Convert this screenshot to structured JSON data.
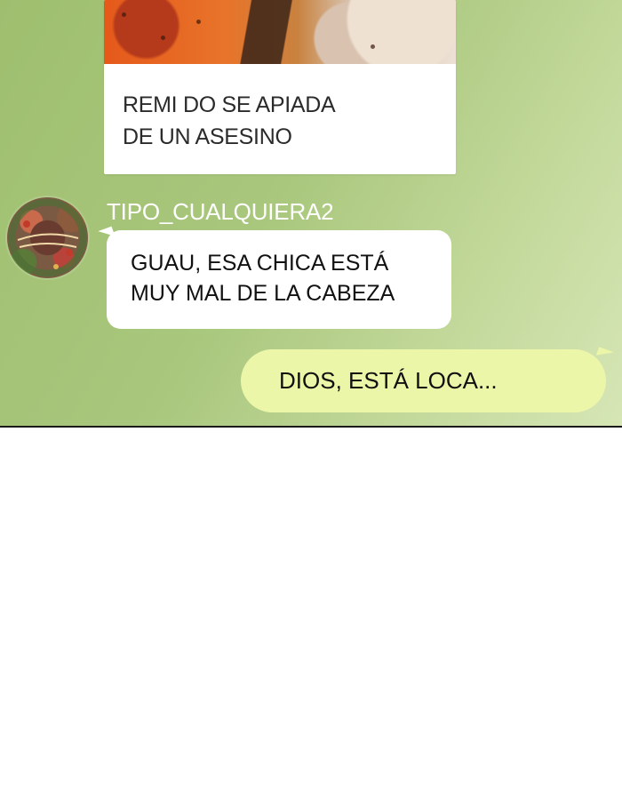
{
  "colors": {
    "chat_background": "#a9c77d",
    "incoming_bubble": "#ffffff",
    "outgoing_bubble": "#ecf6a8",
    "sender_name": "#ffffff"
  },
  "shared_post": {
    "image_icon": "manga-panel-image",
    "caption": "REMI DO SE APIADA\nDE UN ASESINO"
  },
  "incoming_message": {
    "avatar_icon": "merry-christmas-avatar",
    "sender": "TIPO_CUALQUIERA2",
    "text": "GUAU, ESA CHICA ESTÁ\nMUY MAL DE LA CABEZA"
  },
  "outgoing_message": {
    "text": "DIOS, ESTÁ LOCA..."
  }
}
